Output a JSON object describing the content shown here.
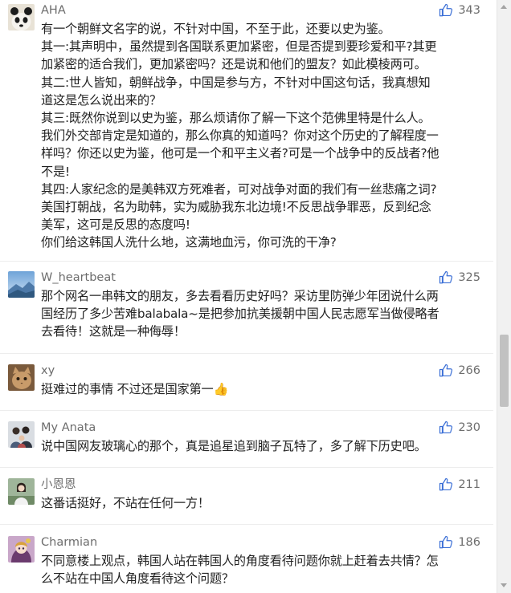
{
  "comments": [
    {
      "username": "AHA",
      "likes": "343",
      "avatar_icon": "avatar-panda-icon",
      "lines": [
        "有一个朝鲜文名字的说，不针对中国，不至于此，还要以史为鉴。",
        "其一:其声明中，虽然提到各国联系更加紧密，但是否提到要珍爱和平?其更",
        "加紧密的适合我们，更加紧密吗？还是说和他们的盟友？如此模棱两可。",
        "其二:世人皆知，朝鲜战争，中国是参与方，不针对中国这句话，我真想知",
        "道这是怎么说出来的？",
        "其三:既然你说到以史为鉴，那么烦请你了解一下这个范佛里特是什么人。",
        "我们外交部肯定是知道的，那么你真的知道吗？你对这个历史的了解程度一",
        "样吗？你还以史为鉴，他可是一个和平主义者?可是一个战争中的反战者?他",
        "不是!",
        "其四:人家纪念的是美韩双方死难者，可对战争对面的我们有一丝悲痛之词?",
        "美国打朝战，名为助韩，实为威胁我东北边境!不反思战争罪恶，反到纪念",
        "美军，这可是反思的态度吗!",
        "你们给这韩国人洗什么地，这满地血污，你可洗的干净?"
      ]
    },
    {
      "username": "W_heartbeat",
      "likes": "325",
      "avatar_icon": "avatar-landscape-icon",
      "lines": [
        "那个网名一串韩文的朋友，多去看看历史好吗？采访里防弹少年团说什么两",
        "国经历了多少苦难balabala~是把参加抗美援朝中国人民志愿军当做侵略者",
        "去看待！这就是一种侮辱！"
      ]
    },
    {
      "username": "xy",
      "likes": "266",
      "avatar_icon": "avatar-cat-icon",
      "lines": [
        "挺难过的事情 不过还是国家第一👍"
      ]
    },
    {
      "username": "My Anata",
      "likes": "230",
      "avatar_icon": "avatar-people-icon",
      "lines": [
        "说中国网友玻璃心的那个，真是追星追到脑子瓦特了，多了解下历史吧。"
      ]
    },
    {
      "username": "小恩恩",
      "likes": "211",
      "avatar_icon": "avatar-person-icon",
      "lines": [
        "这番话挺好，不站在任何一方！"
      ]
    },
    {
      "username": "Charmian",
      "likes": "186",
      "avatar_icon": "avatar-anime-icon",
      "lines": [
        "不同意楼上观点，韩国人站在韩国人的角度看待问题你就上赶着去共情？怎",
        "么不站在中国人角度看待这个问题？"
      ]
    }
  ],
  "colors": {
    "username": "#6d6d6d",
    "text": "#222222",
    "like_icon": "#3b6fd6",
    "separator": "#ededed"
  }
}
